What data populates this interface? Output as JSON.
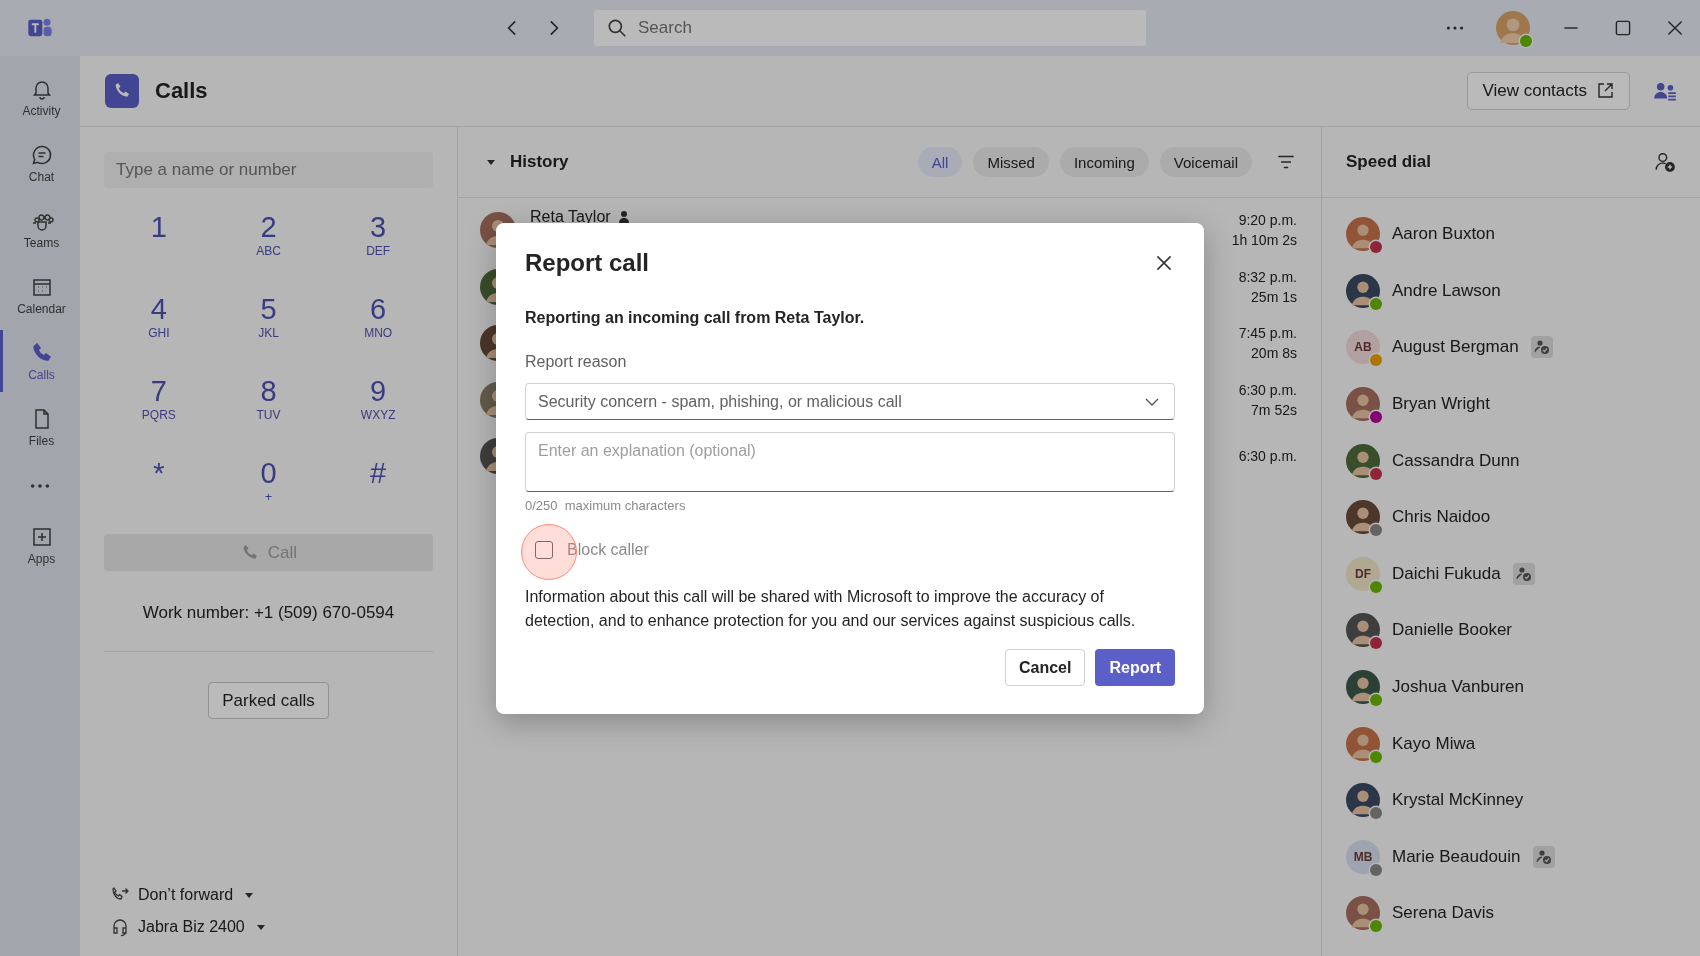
{
  "title_bar": {
    "search_placeholder": "Search",
    "user": {
      "color": "#4e8600"
    }
  },
  "rail": [
    {
      "kind": "app",
      "label": "Activity",
      "selected": false
    },
    {
      "kind": "app",
      "label": "Chat",
      "selected": false
    },
    {
      "kind": "app",
      "label": "Teams",
      "selected": false
    },
    {
      "kind": "app",
      "label": "Calendar",
      "selected": false
    },
    {
      "kind": "app",
      "label": "Calls",
      "selected": true
    },
    {
      "kind": "app",
      "label": "Files",
      "selected": false
    },
    {
      "kind": "more"
    },
    {
      "kind": "app",
      "label": "Apps",
      "selected": false
    }
  ],
  "header": {
    "title": "Calls",
    "view_contacts": "View contacts"
  },
  "dialer": {
    "placeholder": "Type a name or number",
    "keys": [
      {
        "digit": "1"
      },
      {
        "digit": "2",
        "letters": "ABC"
      },
      {
        "digit": "3",
        "letters": "DEF"
      },
      {
        "digit": "4",
        "letters": "GHI"
      },
      {
        "digit": "5",
        "letters": "JKL"
      },
      {
        "digit": "6",
        "letters": "MNO"
      },
      {
        "digit": "7",
        "letters": "PQRS"
      },
      {
        "digit": "8",
        "letters": "TUV"
      },
      {
        "digit": "9",
        "letters": "WXYZ"
      },
      {
        "digit": "*"
      },
      {
        "digit": "0",
        "letters": "+"
      },
      {
        "digit": "#"
      }
    ],
    "call_button": "Call",
    "call_disabled": true,
    "work_number": "Work number: +1 (509) 670-0594",
    "parked_calls": "Parked calls",
    "forwarding": "Don’t forward",
    "device": "Jabra Biz 2400"
  },
  "history": {
    "title": "History",
    "filters": [
      {
        "label": "All",
        "selected": true
      },
      {
        "label": "Missed",
        "selected": false
      },
      {
        "label": "Incoming",
        "selected": false
      },
      {
        "label": "Voicemail",
        "selected": false
      }
    ],
    "rows": [
      {
        "name": "Reta Taylor",
        "time": "9:20 p.m.",
        "duration": "1h 10m 2s"
      },
      {
        "time": "8:32 p.m.",
        "duration": "25m 1s"
      },
      {
        "time": "7:45 p.m.",
        "duration": "20m 8s"
      },
      {
        "time": "6:30 p.m.",
        "duration": "7m 52s"
      },
      {
        "time": "6:30 p.m."
      }
    ]
  },
  "speed_dial": {
    "title": "Speed dial",
    "contacts": [
      {
        "name": "Aaron Buxton",
        "kind": "photo",
        "color": "#8f2437",
        "badge": false
      },
      {
        "name": "Andre Lawson",
        "kind": "photo",
        "color": "#4e8600",
        "badge": false
      },
      {
        "name": "August Bergman",
        "kind": "initials",
        "initials": "AB",
        "color": "#ab7700",
        "badge": true
      },
      {
        "name": "Bryan Wright",
        "kind": "photo",
        "color": "#830073",
        "badge": false
      },
      {
        "name": "Cassandra Dunn",
        "kind": "photo",
        "color": "#8f2437",
        "badge": false
      },
      {
        "name": "Chris Naidoo",
        "kind": "photo",
        "color": "#656362",
        "badge": false
      },
      {
        "name": "Daichi Fukuda",
        "kind": "initials",
        "initials": "DF",
        "color": "#4e8600",
        "badge": true
      },
      {
        "name": "Danielle Booker",
        "kind": "photo",
        "color": "#8f2437",
        "badge": false
      },
      {
        "name": "Joshua Vanburen",
        "kind": "photo",
        "color": "#4e8600",
        "badge": false
      },
      {
        "name": "Kayo Miwa",
        "kind": "photo",
        "color": "#4e8600",
        "badge": false
      },
      {
        "name": "Krystal McKinney",
        "kind": "photo",
        "color": "#656362",
        "badge": false
      },
      {
        "name": "Marie Beaudouin",
        "kind": "initials",
        "initials": "MB",
        "color": "#656362",
        "badge": true
      },
      {
        "name": "Serena Davis",
        "kind": "photo",
        "color": "#4e8600",
        "badge": false
      }
    ]
  },
  "dialog": {
    "title": "Report call",
    "message": "Reporting an incoming call from **Reta Taylor.**",
    "reason_label": "Report reason",
    "reason_value": "Security concern - spam, phishing, or malicious call",
    "explanation_placeholder": "Enter an explanation (optional)",
    "counter": "0/250  maximum characters",
    "block_caller": {
      "label": "Block caller",
      "checked": false
    },
    "info": "Information about this call will be shared with Microsoft to improve the accuracy of detection, and to enhance protection for you and our services against suspicious calls.",
    "cancel": "Cancel",
    "report": "Report"
  }
}
